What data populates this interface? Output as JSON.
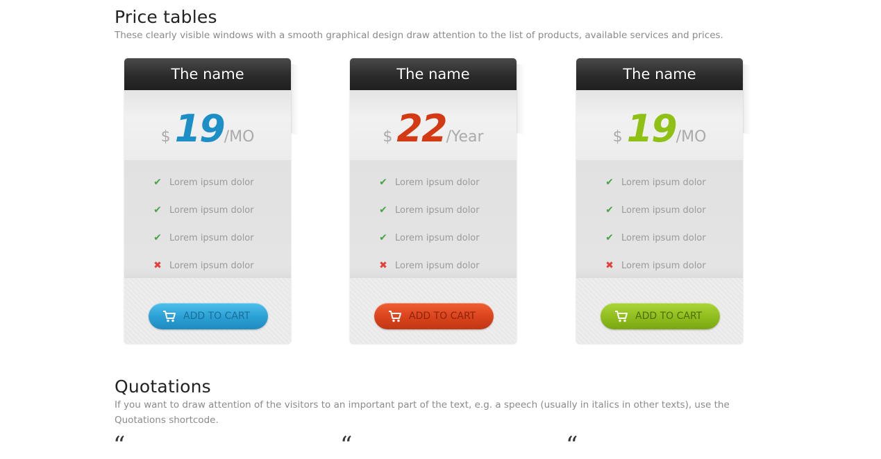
{
  "price_section": {
    "title": "Price tables",
    "description": "These clearly visible windows with a smooth graphical design draw attention to the list of products, available services and prices."
  },
  "cards": [
    {
      "name": "The name",
      "currency": "$",
      "amount": "19",
      "period": "/MO",
      "accent": "#1c8fc6",
      "features": [
        {
          "label": "Lorem ipsum dolor",
          "included": true
        },
        {
          "label": "Lorem ipsum dolor",
          "included": true
        },
        {
          "label": "Lorem ipsum dolor",
          "included": true
        },
        {
          "label": "Lorem ipsum dolor",
          "included": false
        }
      ],
      "button_label": "ADD TO CART"
    },
    {
      "name": "The name",
      "currency": "$",
      "amount": "22",
      "period": "/Year",
      "accent": "#d33a14",
      "features": [
        {
          "label": "Lorem ipsum dolor",
          "included": true
        },
        {
          "label": "Lorem ipsum dolor",
          "included": true
        },
        {
          "label": "Lorem ipsum dolor",
          "included": true
        },
        {
          "label": "Lorem ipsum dolor",
          "included": false
        }
      ],
      "button_label": "ADD TO CART"
    },
    {
      "name": "The name",
      "currency": "$",
      "amount": "19",
      "period": "/MO",
      "accent": "#8fc114",
      "features": [
        {
          "label": "Lorem ipsum dolor",
          "included": true
        },
        {
          "label": "Lorem ipsum dolor",
          "included": true
        },
        {
          "label": "Lorem ipsum dolor",
          "included": true
        },
        {
          "label": "Lorem ipsum dolor",
          "included": false
        }
      ],
      "button_label": "ADD TO CART"
    }
  ],
  "icons": {
    "check": "✔",
    "cross": "✖",
    "quote": "“"
  },
  "quotations_section": {
    "title": "Quotations",
    "description": "If you want to draw attention of the visitors to an important part of the text, e.g. a speech (usually in italics in other texts), use the Quotations shortcode."
  }
}
